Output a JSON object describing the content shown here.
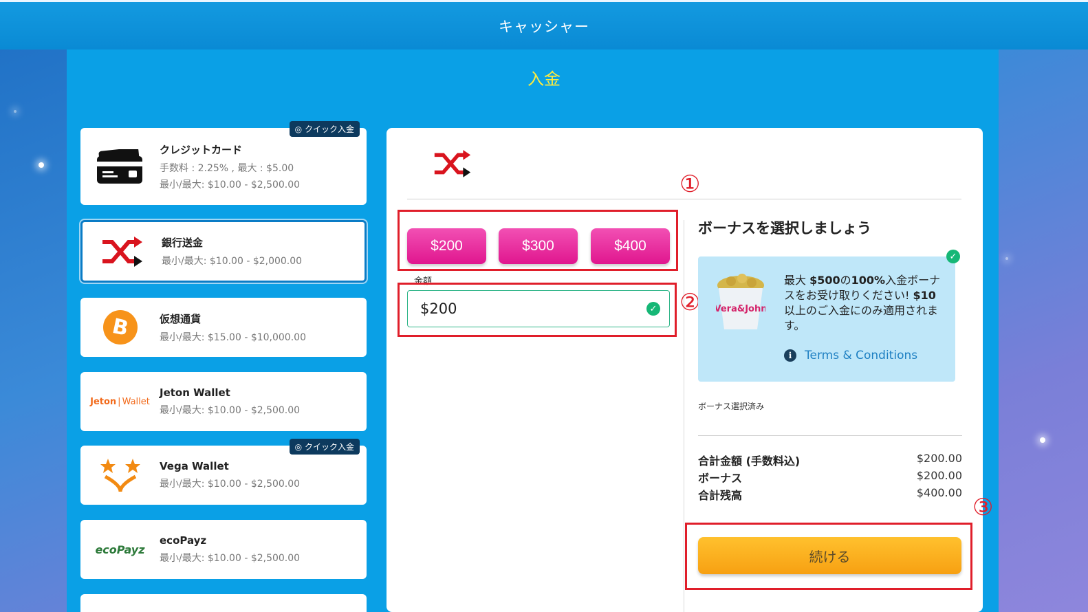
{
  "header": {
    "title": "キャッシャー"
  },
  "page": {
    "title": "入金"
  },
  "methods": [
    {
      "name": "クレジットカード",
      "line1": "手数料 : 2.25% , 最大 : $5.00",
      "line2": "最小/最大: $10.00 - $2,500.00",
      "badge": "クイック入金",
      "icon": "credit-card-icon"
    },
    {
      "name": "銀行送金",
      "line1": "最小/最大: $10.00 - $2,000.00",
      "icon": "bank-transfer-shuffle-icon"
    },
    {
      "name": "仮想通貨",
      "line1": "最小/最大: $15.00 - $10,000.00",
      "icon": "bitcoin-icon"
    },
    {
      "name": "Jeton Wallet",
      "line1": "最小/最大: $10.00 - $2,500.00",
      "logo_text": "Jeton",
      "logo_text2": "Wallet"
    },
    {
      "name": "Vega Wallet",
      "line1": "最小/最大: $10.00 - $2,500.00",
      "badge": "クイック入金",
      "icon": "vega-stars-icon"
    },
    {
      "name": "ecoPayz",
      "line1": "最小/最大: $10.00 - $2,500.00",
      "logo_text": "ecoPayz"
    }
  ],
  "annotations": {
    "one": "①",
    "two": "②",
    "three": "③"
  },
  "amounts": {
    "a1": "$200",
    "a2": "$300",
    "a3": "$400"
  },
  "amount_field": {
    "label": "金額",
    "value": "$200"
  },
  "bonus": {
    "title": "ボーナスを選択しましょう",
    "image_text": "Vera&John",
    "text_a": "最大 ",
    "text_b": "$500",
    "text_c": "の",
    "text_d": "100%",
    "text_e": "入金ボーナスをお受け取りください! ",
    "text_f": "$10",
    "text_g": "以上のご入金にのみ適用されます。",
    "terms": "Terms & Conditions",
    "selected": "ボーナス選択済み"
  },
  "summary": [
    {
      "label": "合計金額 (手数料込)",
      "value": "$200.00"
    },
    {
      "label": "ボーナス",
      "value": "$200.00"
    },
    {
      "label": "合計残高",
      "value": "$400.00"
    }
  ],
  "continue_label": "続ける",
  "colors": {
    "accent_pink": "#e0168e",
    "accent_orange": "#f7a012",
    "annotation_red": "#e01e2a"
  }
}
